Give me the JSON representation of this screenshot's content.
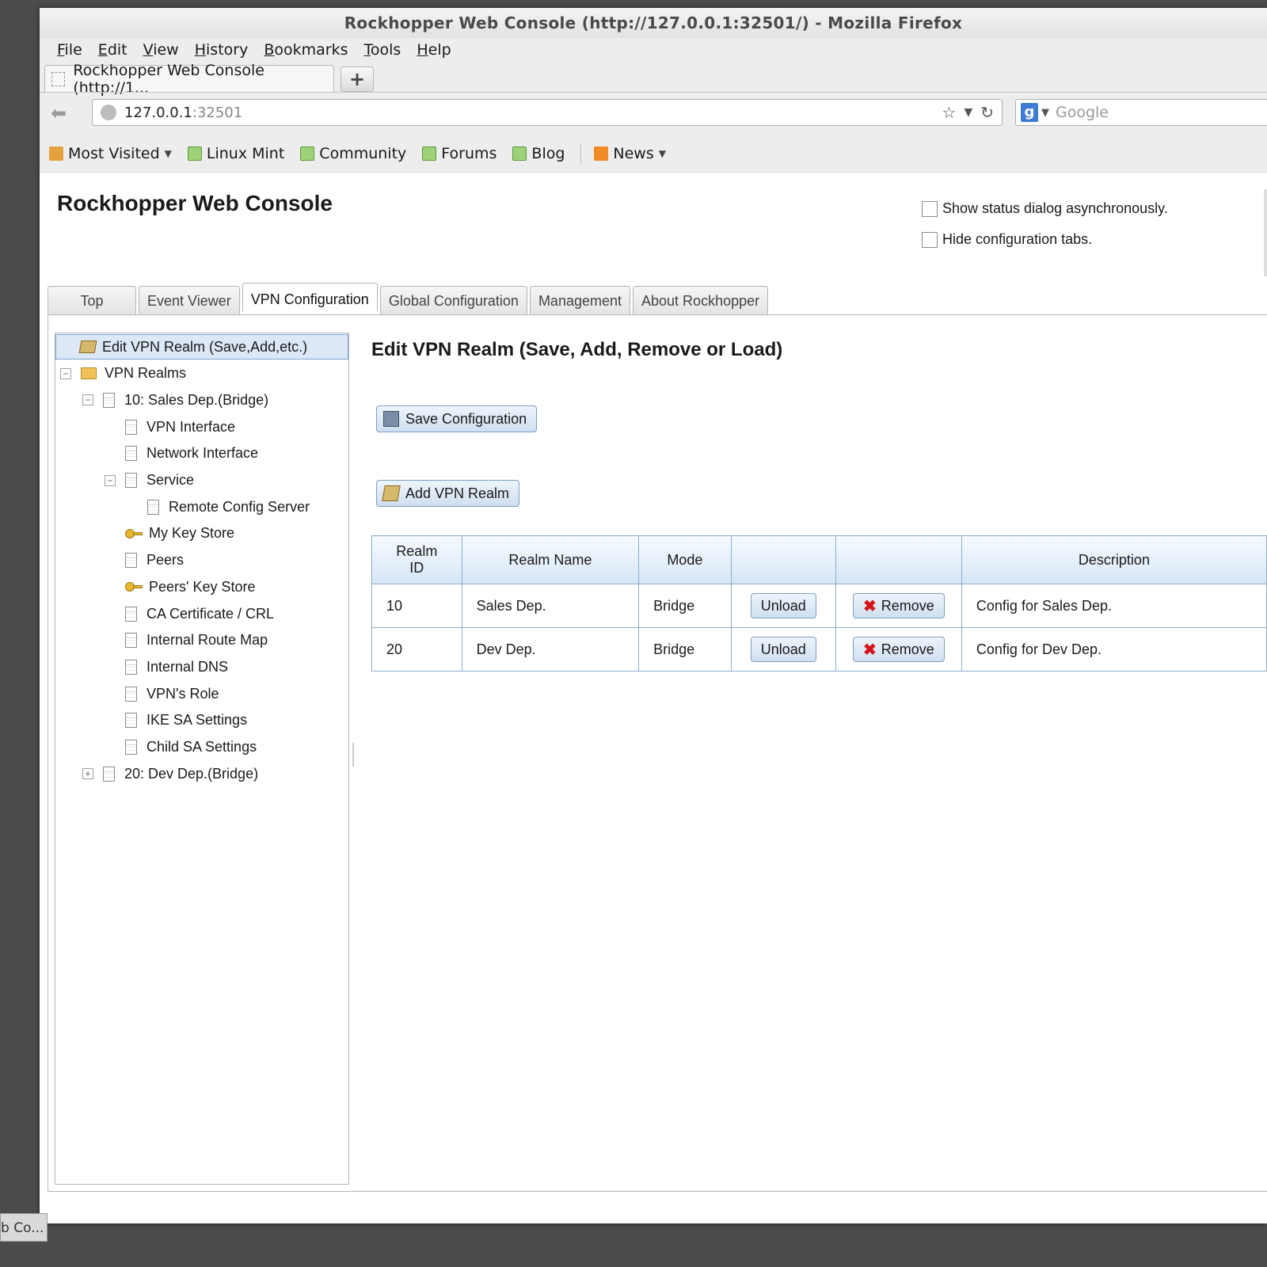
{
  "window_title": "Rockhopper Web Console (http://127.0.0.1:32501/) - Mozilla Firefox",
  "menu": [
    "File",
    "Edit",
    "View",
    "History",
    "Bookmarks",
    "Tools",
    "Help"
  ],
  "browser_tab": {
    "label": "Rockhopper Web Console (http://1...",
    "new_tab_label": "+"
  },
  "url": {
    "host": "127.0.0.1",
    "port": ":32501"
  },
  "search": {
    "engine_icon": "g",
    "placeholder": "Google"
  },
  "bookmarks": [
    {
      "label": "Most Visited",
      "icon": "folder-icon",
      "dropdown": true
    },
    {
      "label": "Linux Mint",
      "icon": "mint-icon"
    },
    {
      "label": "Community",
      "icon": "mint-icon"
    },
    {
      "label": "Forums",
      "icon": "mint-icon"
    },
    {
      "label": "Blog",
      "icon": "mint-icon"
    },
    {
      "label": "News",
      "icon": "rss-icon",
      "dropdown": true
    }
  ],
  "app": {
    "title": "Rockhopper Web Console",
    "options": {
      "async_status": "Show status dialog asynchronously.",
      "hide_tabs": "Hide configuration tabs."
    },
    "tabs": [
      "Top",
      "Event Viewer",
      "VPN Configuration",
      "Global Configuration",
      "Management",
      "About Rockhopper"
    ],
    "active_tab": "VPN Configuration"
  },
  "tree": [
    {
      "label": "Edit VPN Realm (Save,Add,etc.)",
      "icon": "edit",
      "level": 0,
      "selected": true
    },
    {
      "label": "VPN Realms",
      "icon": "folder",
      "level": 0,
      "toggle": "−"
    },
    {
      "label": "10: Sales Dep.(Bridge)",
      "icon": "doc",
      "level": 1,
      "toggle": "−"
    },
    {
      "label": "VPN Interface",
      "icon": "doc",
      "level": 2
    },
    {
      "label": "Network Interface",
      "icon": "doc",
      "level": 2
    },
    {
      "label": "Service",
      "icon": "doc",
      "level": 2,
      "toggle": "−"
    },
    {
      "label": "Remote Config Server",
      "icon": "doc",
      "level": 3
    },
    {
      "label": "My Key Store",
      "icon": "key",
      "level": 2
    },
    {
      "label": "Peers",
      "icon": "doc",
      "level": 2
    },
    {
      "label": "Peers' Key Store",
      "icon": "key",
      "level": 2
    },
    {
      "label": "CA Certificate / CRL",
      "icon": "doc",
      "level": 2
    },
    {
      "label": "Internal Route Map",
      "icon": "doc",
      "level": 2
    },
    {
      "label": "Internal DNS",
      "icon": "doc",
      "level": 2
    },
    {
      "label": "VPN's Role",
      "icon": "doc",
      "level": 2
    },
    {
      "label": "IKE SA Settings",
      "icon": "doc",
      "level": 2
    },
    {
      "label": "Child SA Settings",
      "icon": "doc",
      "level": 2
    },
    {
      "label": "20: Dev Dep.(Bridge)",
      "icon": "doc",
      "level": 1,
      "toggle": "+"
    }
  ],
  "content": {
    "title": "Edit VPN Realm (Save, Add, Remove or Load)",
    "save_button": "Save Configuration",
    "add_button": "Add VPN Realm",
    "table": {
      "headers": {
        "id_line1": "Realm",
        "id_line2": "ID",
        "name": "Realm Name",
        "mode": "Mode",
        "col4": "",
        "col5": "",
        "description": "Description"
      },
      "rows": [
        {
          "id": "10",
          "name": "Sales Dep.",
          "mode": "Bridge",
          "unload": "Unload",
          "remove": "Remove",
          "description": "Config for Sales Dep."
        },
        {
          "id": "20",
          "name": "Dev Dep.",
          "mode": "Bridge",
          "unload": "Unload",
          "remove": "Remove",
          "description": "Config for Dev Dep."
        }
      ]
    }
  },
  "taskbar": {
    "item": "b Co..."
  }
}
